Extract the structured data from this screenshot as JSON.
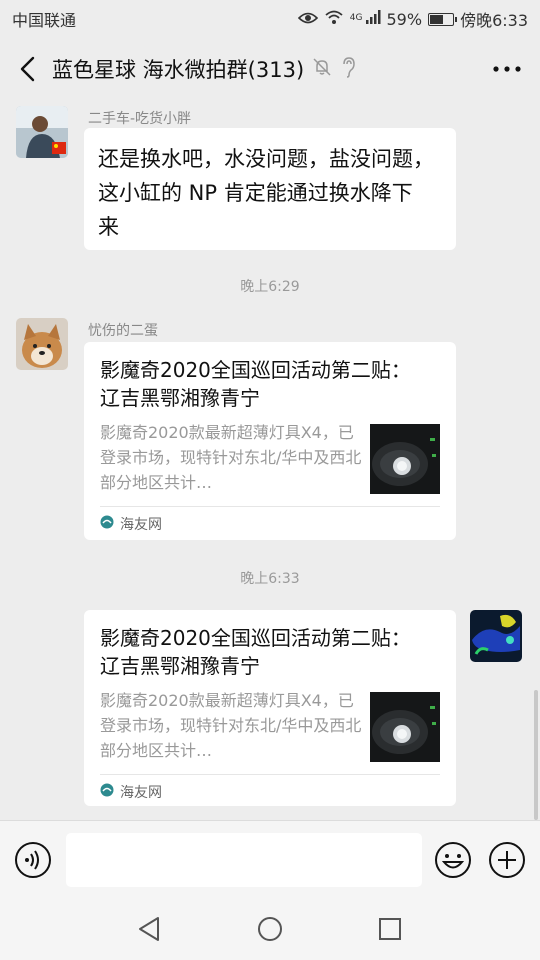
{
  "status": {
    "carrier": "中国联通",
    "network": "4G",
    "battery": "59%",
    "battery_level": 0.59,
    "time": "傍晚6:33"
  },
  "header": {
    "title": "蓝色星球 海水微拍群(313)"
  },
  "messages": [
    {
      "sender": "二手车-吃货小胖",
      "text": "还是换水吧，水没问题，盐没问题，这小缸的 NP 肯定能通过换水降下来",
      "line1": "还是换水吧，水没问题，盐没问题，",
      "line2": "这小缸的 NP 肯定能通过换水降下",
      "line3": "来"
    },
    {
      "time": "晚上6:29"
    },
    {
      "sender": "忧伤的二蛋",
      "card_title": "影魔奇2020全国巡回活动第二贴： 辽吉黑鄂湘豫青宁",
      "card_desc": "影魔奇2020款最新超薄灯具X4，已登录市场，现特针对东北/华中及西北部分地区共计…",
      "card_source": "海友网"
    },
    {
      "time": "晚上6:33"
    },
    {
      "card_title": "影魔奇2020全国巡回活动第二贴： 辽吉黑鄂湘豫青宁",
      "card_desc": "影魔奇2020款最新超薄灯具X4，已登录市场，现特针对东北/华中及西北部分地区共计…",
      "card_source": "海友网"
    }
  ],
  "input": {
    "placeholder": ""
  },
  "colors": {
    "background": "#ededed",
    "bubble": "#ffffff",
    "timestamp": "#9a9a9a"
  },
  "icons": [
    "back-icon",
    "mute-icon",
    "ear-icon",
    "more-icon",
    "voice-icon",
    "emoji-icon",
    "plus-icon",
    "nav-back-icon",
    "nav-home-icon",
    "nav-recent-icon",
    "source-logo-icon"
  ]
}
